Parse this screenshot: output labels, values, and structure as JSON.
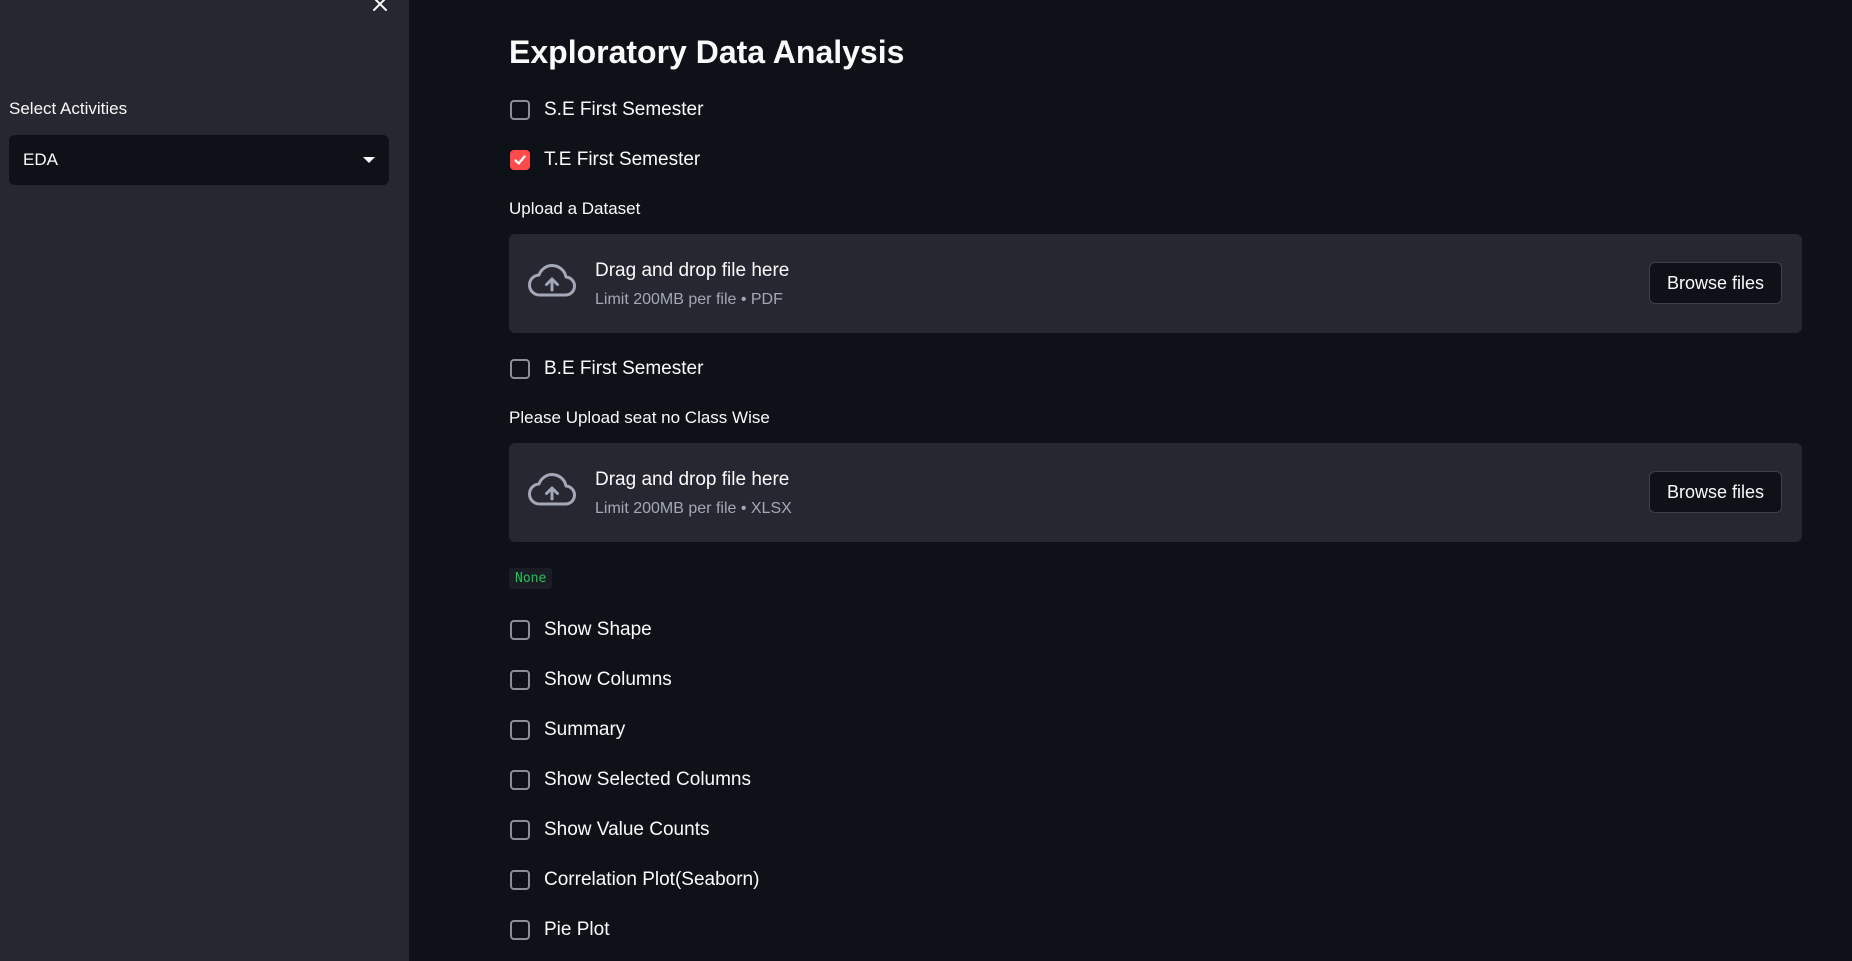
{
  "sidebar": {
    "close_icon": "close-icon",
    "select_label": "Select Activities",
    "select_value": "EDA"
  },
  "main": {
    "title": "Exploratory Data Analysis",
    "semesters": [
      {
        "label": "S.E First Semester",
        "checked": false
      },
      {
        "label": "T.E First Semester",
        "checked": true
      },
      {
        "label": "B.E First Semester",
        "checked": false
      }
    ],
    "upload_dataset": {
      "label": "Upload a Dataset",
      "drop_title": "Drag and drop file here",
      "limit": "Limit 200MB per file • PDF",
      "button": "Browse files"
    },
    "upload_seat": {
      "label": "Please Upload seat no Class Wise",
      "drop_title": "Drag and drop file here",
      "limit": "Limit 200MB per file • XLSX",
      "button": "Browse files"
    },
    "output_badge": "None",
    "options": [
      {
        "label": "Show Shape",
        "checked": false
      },
      {
        "label": "Show Columns",
        "checked": false
      },
      {
        "label": "Summary",
        "checked": false
      },
      {
        "label": "Show Selected Columns",
        "checked": false
      },
      {
        "label": "Show Value Counts",
        "checked": false
      },
      {
        "label": "Correlation Plot(Seaborn)",
        "checked": false
      },
      {
        "label": "Pie Plot",
        "checked": false
      }
    ]
  },
  "colors": {
    "background": "#0e1117",
    "sidebar": "#262730",
    "accent": "#ff4b4b",
    "success_text": "#21c354"
  }
}
